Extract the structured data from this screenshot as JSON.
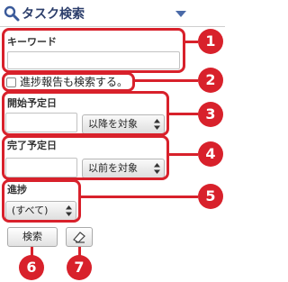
{
  "header": {
    "title": "タスク検索"
  },
  "keyword": {
    "label": "キーワード",
    "value": ""
  },
  "progress_report_check": {
    "label": "進捗報告も検索する。",
    "checked": false
  },
  "start_date": {
    "label": "開始予定日",
    "value": "",
    "option": "以降を対象"
  },
  "end_date": {
    "label": "完了予定日",
    "value": "",
    "option": "以前を対象"
  },
  "progress": {
    "label": "進捗",
    "option": "(すべて)"
  },
  "buttons": {
    "search": "検索"
  },
  "callouts": [
    "1",
    "2",
    "3",
    "4",
    "5",
    "6",
    "7"
  ],
  "colors": {
    "accent": "#d8212b",
    "title": "#2c3e6b"
  }
}
